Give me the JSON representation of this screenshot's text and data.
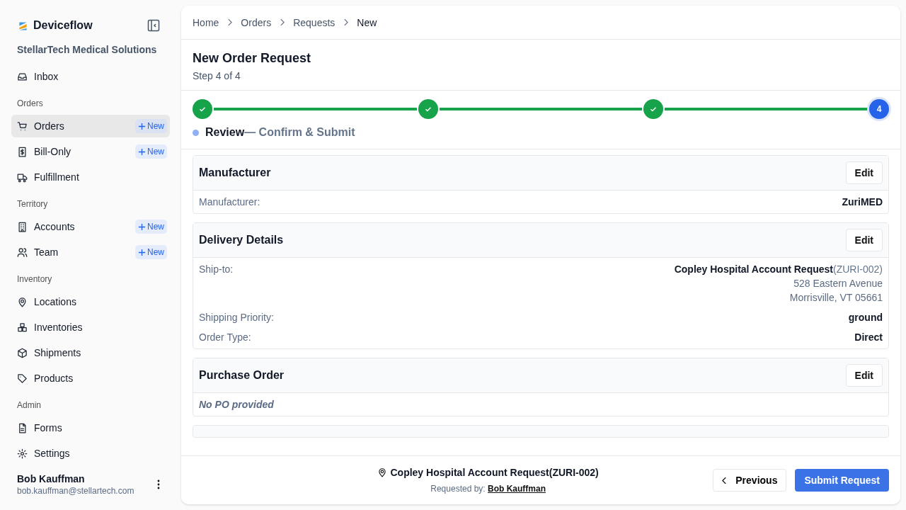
{
  "brand": {
    "name": "Deviceflow",
    "organization": "StellarTech Medical Solutions"
  },
  "nav": [
    {
      "items": [
        {
          "label": "Inbox",
          "selected": false
        }
      ]
    },
    {
      "heading": "Orders",
      "items": [
        {
          "label": "Orders",
          "selected": true,
          "badge": "New"
        },
        {
          "label": "Bill-Only",
          "selected": false,
          "badge": "New"
        },
        {
          "label": "Fulfillment",
          "selected": false
        }
      ]
    },
    {
      "heading": "Territory",
      "items": [
        {
          "label": "Accounts",
          "selected": false,
          "badge": "New"
        },
        {
          "label": "Team",
          "selected": false,
          "badge": "New"
        }
      ]
    },
    {
      "heading": "Inventory",
      "items": [
        {
          "label": "Locations",
          "selected": false
        },
        {
          "label": "Inventories",
          "selected": false
        },
        {
          "label": "Shipments",
          "selected": false
        },
        {
          "label": "Products",
          "selected": false
        }
      ]
    },
    {
      "heading": "Admin",
      "items": [
        {
          "label": "Forms",
          "selected": false
        },
        {
          "label": "Settings",
          "selected": false
        }
      ]
    }
  ],
  "user": {
    "name": "Bob Kauffman",
    "email": "bob.kauffman@stellartech.com"
  },
  "breadcrumb": [
    "Home",
    "Orders",
    "Requests",
    "New"
  ],
  "page": {
    "title": "New Order Request",
    "subtitle": "Step 4 of 4"
  },
  "steps": [
    {
      "completed": true
    },
    {
      "completed": true
    },
    {
      "completed": true
    },
    {
      "completed": false,
      "number": "4"
    }
  ],
  "current_step": {
    "label": "Review",
    "description": "— Confirm & Submit"
  },
  "sections": [
    {
      "title": "Manufacturer",
      "edit": "Edit",
      "rows": [
        {
          "label": "Manufacturer:",
          "value": "ZuriMED"
        }
      ]
    },
    {
      "title": "Delivery Details",
      "edit": "Edit",
      "rows": [
        {
          "label": "Ship-to:",
          "value": "Copley Hospital Account Request",
          "note": "(ZURI-002)",
          "lines": [
            "528 Eastern Avenue",
            "Morrisville, VT 05661"
          ]
        },
        {
          "label": "Shipping Priority:",
          "value": "ground"
        },
        {
          "label": "Order Type:",
          "value": "Direct"
        }
      ]
    },
    {
      "title": "Purchase Order",
      "edit": "Edit",
      "empty": "No PO provided"
    }
  ],
  "footer": {
    "account": "Copley Hospital Account Request(ZURI-002)",
    "requested_by_label": "Requested by:",
    "requested_by": "Bob Kauffman",
    "previous": "Previous",
    "submit": "Submit Request"
  }
}
